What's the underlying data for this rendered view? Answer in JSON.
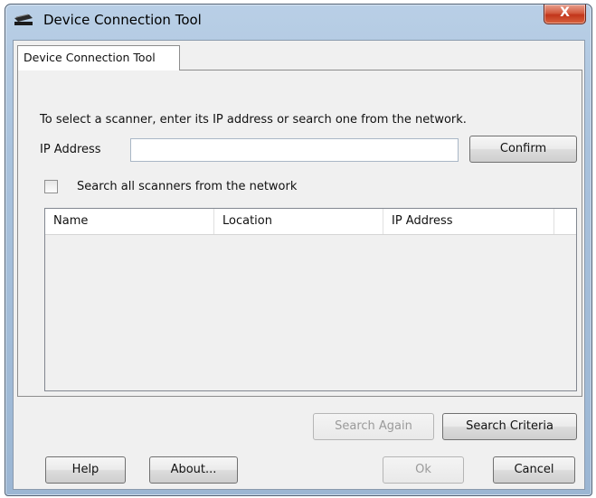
{
  "window": {
    "title": "Device Connection Tool",
    "close_glyph": "X",
    "icon": "scanner-icon"
  },
  "tab": {
    "label": "Device Connection Tool"
  },
  "panel": {
    "instruction": "To select a scanner,  enter its IP address or search one from the network.",
    "ip_label": "IP Address",
    "ip_value": "",
    "confirm_label": "Confirm",
    "search_all_label": "Search all scanners from the network",
    "search_all_checked": false
  },
  "table": {
    "columns": [
      "Name",
      "Location",
      "IP Address"
    ],
    "rows": []
  },
  "actions": {
    "search_again_label": "Search Again",
    "search_again_enabled": false,
    "search_criteria_label": "Search Criteria"
  },
  "footer": {
    "help_label": "Help",
    "about_label": "About...",
    "ok_label": "Ok",
    "ok_enabled": false,
    "cancel_label": "Cancel"
  }
}
